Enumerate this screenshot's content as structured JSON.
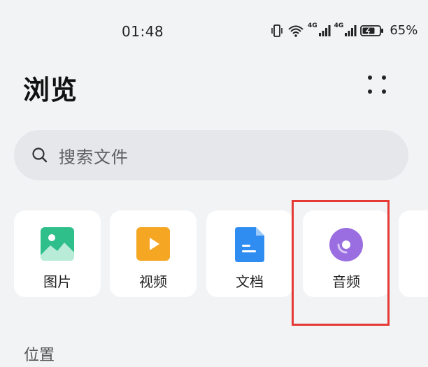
{
  "status_bar": {
    "time": "01:48",
    "network_label_1": "4G",
    "network_label_2": "4G",
    "battery_percent": "65%",
    "icons": [
      "vibrate-icon",
      "wifi-icon",
      "signal-icon",
      "signal-icon",
      "battery-charging-icon"
    ]
  },
  "header": {
    "title": "浏览",
    "more_icon": "more-dots-icon"
  },
  "search": {
    "placeholder": "搜索文件",
    "icon": "search-icon"
  },
  "categories": [
    {
      "label": "图片",
      "icon": "image-icon",
      "color": "#2fbf8a"
    },
    {
      "label": "视频",
      "icon": "video-icon",
      "color": "#f5a623"
    },
    {
      "label": "文档",
      "icon": "document-icon",
      "color": "#2f8cf0"
    },
    {
      "label": "音频",
      "icon": "audio-disc-icon",
      "color": "#9a6ee0"
    }
  ],
  "section": {
    "title": "位置"
  },
  "highlight": {
    "target": "音频",
    "color": "#e53935"
  }
}
